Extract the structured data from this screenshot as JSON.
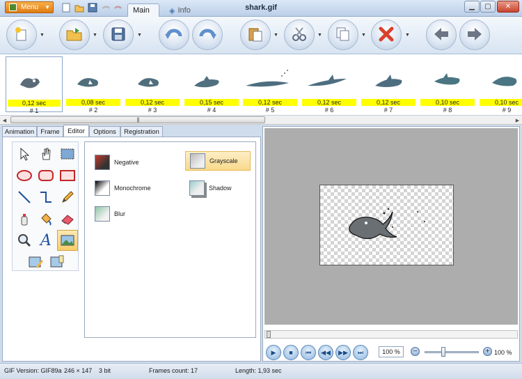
{
  "app": {
    "menu_label": "Menu",
    "window_title": "shark.gif",
    "tabs": [
      {
        "label": "Main"
      },
      {
        "label": "Info"
      }
    ]
  },
  "toolbar": {
    "buttons": [
      "new-icon",
      "open-icon",
      "save-icon",
      "undo-icon",
      "redo-icon",
      "paste-icon",
      "cut-icon",
      "copy-icon",
      "delete-icon",
      "back-icon",
      "forward-icon"
    ]
  },
  "frames": [
    {
      "delay": "0,12 sec",
      "number": "# 1"
    },
    {
      "delay": "0,08 sec",
      "number": "# 2"
    },
    {
      "delay": "0,12 sec",
      "number": "# 3"
    },
    {
      "delay": "0,15 sec",
      "number": "# 4"
    },
    {
      "delay": "0,12 sec",
      "number": "# 5"
    },
    {
      "delay": "0,12 sec",
      "number": "# 6"
    },
    {
      "delay": "0,12 sec",
      "number": "# 7"
    },
    {
      "delay": "0,10 sec",
      "number": "# 8"
    },
    {
      "delay": "0,10 sec",
      "number": "# 9"
    }
  ],
  "left_tabs": [
    {
      "label": "Animation"
    },
    {
      "label": "Frame"
    },
    {
      "label": "Editor"
    },
    {
      "label": "Options"
    },
    {
      "label": "Registration"
    }
  ],
  "tools": [
    "arrow-icon",
    "hand-icon",
    "select-icon",
    "ellipse-icon",
    "rounded-rect-icon",
    "rectangle-icon",
    "line-icon",
    "polyline-icon",
    "pencil-icon",
    "spray-icon",
    "fill-icon",
    "eraser-icon",
    "zoom-icon",
    "text-icon",
    "image-icon",
    "edit-image-icon",
    "image-props-icon"
  ],
  "effects": [
    {
      "label": "Negative"
    },
    {
      "label": "Grayscale"
    },
    {
      "label": "Monochrome"
    },
    {
      "label": "Shadow"
    },
    {
      "label": "Blur"
    }
  ],
  "player": {
    "zoom_value": "100 %",
    "zoom_label": "100 %"
  },
  "status": {
    "gif_version": "GIF Version: GIF89a",
    "size": "246 × 147",
    "bits": "3 bit",
    "frames_count": "Frames count: 17",
    "length": "Length: 1,93 sec"
  }
}
